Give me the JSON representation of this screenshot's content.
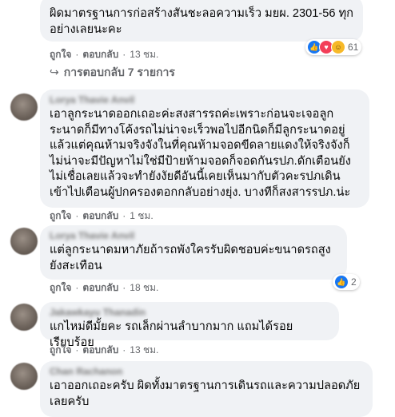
{
  "comments": [
    {
      "author": "",
      "text": "ผิดมาตรฐานการก่อสร้างสันชะลอความเร็ว มยผ. 2301-56 ทุกอย่างเลยนะคะ",
      "actions": {
        "like": "ถูกใจ",
        "reply": "ตอบกลับ",
        "time": "13 ชม."
      },
      "reactions": {
        "count": "61",
        "icons": [
          "like-icon",
          "love-icon",
          "haha-icon"
        ]
      },
      "replies_label": "การตอบกลับ 7 รายการ"
    },
    {
      "author": "Lorya Thavie Anvil",
      "text": "เอาลูกระนาดออกเถอะค่ะสงสารรถค่ะเพราะก่อนจะเจอลูกระนาดก็มีทางโค้งรถไม่น่าจะเร็วพอไปอีกนิดก็มีลูกระนาดอยู่แล้วแต่คุณห้ามจริงจังในที่คุณห้ามจอดขีดลายแดงให้จริงจังก็ไม่น่าจะมีปัญหาไม่ใช่มีป้ายห้ามจอดก็จอดกันรปภ.ดักเตือนยังไม่เชื่อเลยแล้วจะทำยังงัยดีอันนี้เคยเห็นมากับตัวคะรปภเดินเข้าไปเตือนผู้ปกครองตอกกลับอย่างยุ่ง. บางทีก็สงสารรปภ.น่ะ",
      "actions": {
        "like": "ถูกใจ",
        "reply": "ตอบกลับ",
        "time": "1 ชม."
      }
    },
    {
      "author": "Lorya Thavie Anvil",
      "text": "แต่ลูกระนาดมหาภัยถ้ารถพังใครรับผิดชอบค่ะขนาดรถสูงยังสะเทือน",
      "actions": {
        "like": "ถูกใจ",
        "reply": "ตอบกลับ",
        "time": "18 ชม."
      },
      "reactions": {
        "count": "2",
        "icons": [
          "like-icon"
        ]
      }
    },
    {
      "author": "Jakawkayu Thanadin",
      "text": "แกไหม่ดีมั้ยคะ รถเล็กผ่านลำบากมาก แถมได้รอยเรียบร้อย",
      "actions": {
        "like": "ถูกใจ",
        "reply": "ตอบกลับ",
        "time": "13 ชม."
      }
    },
    {
      "author": "Chan Rachanon",
      "text": "เอาออกเถอะครับ ผิดทั้งมาตรฐานการเดินรถและความปลอดภัยเลยครับ",
      "actions": {}
    }
  ]
}
